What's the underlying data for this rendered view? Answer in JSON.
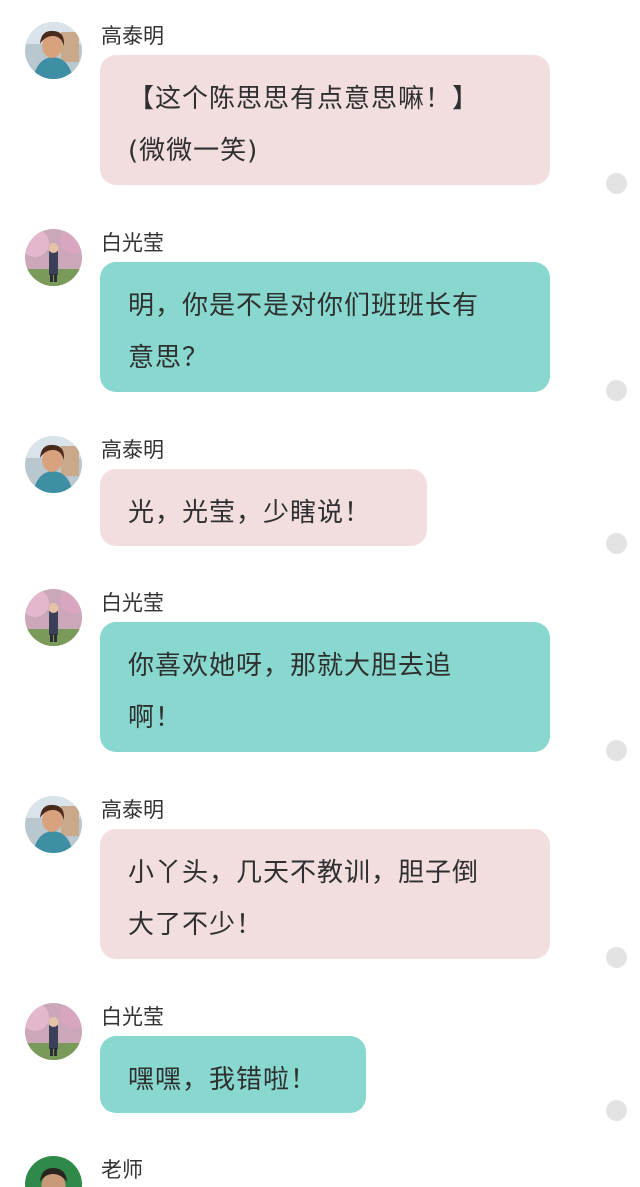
{
  "messages": [
    {
      "sender": "高泰明",
      "lines": [
        "【这个陈思思有点意思嘛！】",
        "(微微一笑)"
      ],
      "style": "pink",
      "avatar": "gao-avatar"
    },
    {
      "sender": "白光莹",
      "lines": [
        "明，你是不是对你们班班长有",
        "意思？"
      ],
      "style": "teal",
      "avatar": "bai-avatar"
    },
    {
      "sender": "高泰明",
      "lines": [
        "光，光莹，少瞎说！"
      ],
      "style": "pink",
      "avatar": "gao-avatar"
    },
    {
      "sender": "白光莹",
      "lines": [
        "你喜欢她呀，那就大胆去追",
        "啊！"
      ],
      "style": "teal",
      "avatar": "bai-avatar"
    },
    {
      "sender": "高泰明",
      "lines": [
        "小丫头，几天不教训，胆子倒",
        "大了不少！"
      ],
      "style": "pink",
      "avatar": "gao-avatar"
    },
    {
      "sender": "白光莹",
      "lines": [
        "嘿嘿，我错啦！"
      ],
      "style": "teal",
      "avatar": "bai-avatar"
    },
    {
      "sender": "老师",
      "lines": [],
      "style": "none",
      "avatar": "teacher-avatar"
    }
  ],
  "colors": {
    "pink_bubble": "#f2dedf",
    "teal_bubble": "#88d8cf",
    "status_dot": "#e3e3e3"
  }
}
